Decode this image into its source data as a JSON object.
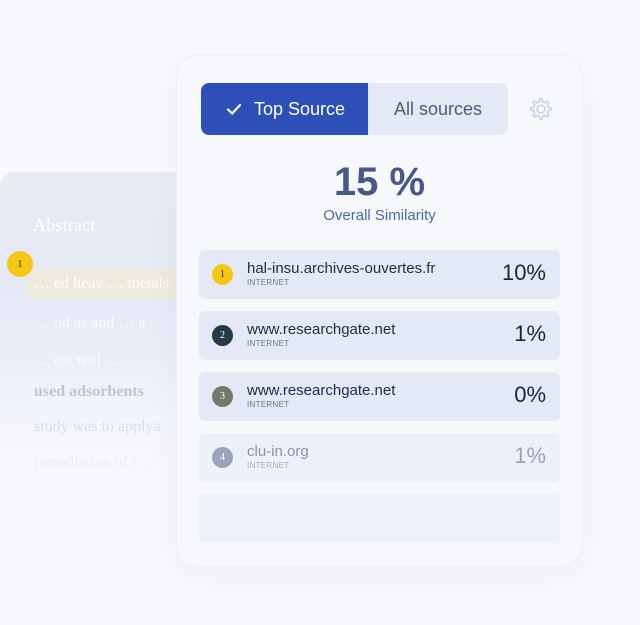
{
  "document": {
    "title": "Abstract",
    "marker_number": "1",
    "highlighted_text": "… ed heav … metals",
    "lines": [
      "… od as and … a",
      "… ost wid …",
      "used adsorbents",
      "study was to applya",
      "remediation of r…"
    ]
  },
  "tabs": {
    "top_source_label": "Top Source",
    "all_sources_label": "All sources"
  },
  "similarity": {
    "value": "15 %",
    "label": "Overall Similarity"
  },
  "sources": [
    {
      "rank": "1",
      "domain": "hal-insu.archives-ouvertes.fr",
      "type": "INTERNET",
      "percent": "10%",
      "badge_color": "#f7c716",
      "badge_text_color": "#3a3a3a"
    },
    {
      "rank": "2",
      "domain": "www.researchgate.net",
      "type": "INTERNET",
      "percent": "1%",
      "badge_color": "#263a4c",
      "badge_text_color": "#ffffff"
    },
    {
      "rank": "3",
      "domain": "www.researchgate.net",
      "type": "INTERNET",
      "percent": "0%",
      "badge_color": "#747a6a",
      "badge_text_color": "#ffffff"
    },
    {
      "rank": "4",
      "domain": "clu-in.org",
      "type": "INTERNET",
      "percent": "1%",
      "badge_color": "#9aa2bc",
      "badge_text_color": "#ffffff"
    }
  ],
  "colors": {
    "accent": "#2c50b8",
    "tab_inactive": "#e4e9f6",
    "similarity_value": "#485887",
    "similarity_label": "#4a67b0"
  }
}
